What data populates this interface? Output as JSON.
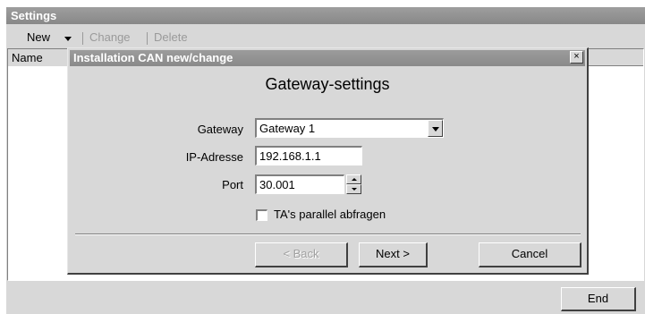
{
  "settings_window": {
    "title": "Settings",
    "toolbar": {
      "new_label": "New",
      "change_label": "Change",
      "delete_label": "Delete"
    },
    "list": {
      "columns": [
        "Name"
      ]
    },
    "end_label": "End"
  },
  "dialog": {
    "title": "Installation CAN new/change",
    "close_glyph": "×",
    "heading": "Gateway-settings",
    "gateway": {
      "label": "Gateway",
      "value": "Gateway 1"
    },
    "ip": {
      "label": "IP-Adresse",
      "value": "192.168.1.1"
    },
    "port": {
      "label": "Port",
      "value": "30.001"
    },
    "parallel": {
      "label": "TA's parallel abfragen",
      "checked": false
    },
    "buttons": {
      "back_label": "< Back",
      "next_label": "Next >",
      "cancel_label": "Cancel"
    }
  },
  "colors": {
    "title_bar": "#8e8e8e",
    "face": "#d8d8d8"
  }
}
